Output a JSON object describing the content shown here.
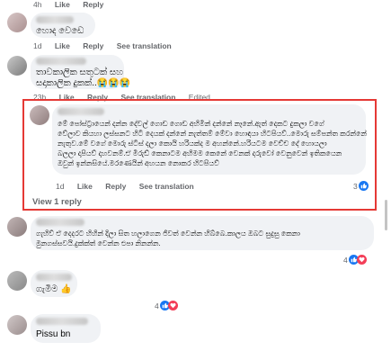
{
  "actions": {
    "like": "Like",
    "reply": "Reply",
    "see_translation": "See translation",
    "edited": "Edited",
    "view_replies": "View 1 reply"
  },
  "comments": [
    {
      "time": "4h",
      "text": ""
    },
    {
      "time": "1d",
      "text": "හොද වෙඩෙ"
    },
    {
      "time": "23h",
      "text_line1": "තාවකාලික සතුටක් සහ",
      "text_line2": "සදාකාලික දුකක්..😭😭😭"
    },
    {
      "time": "1d",
      "text_lines": [
        "මේ පෝස්ට්‍රායෙන් දන්න දේවල් ගොඩ ගොඩ අහිමින් දන්නේ නෑනේ.ඇත් දෙකට දුකලා වගේ",
        "වේලාව කියහා ලස්සනට හිටි දෙයක් දන්නේ නැත්තම් මේවා හොඳයා හිටපියව්..මොරු සම්පන්ත කරන්නේ",
        "නැතුව.මේ වගේ මොරු ස්ටිස් දලා කොයි හරියක්ද ම අහන්නේ.හරියටම වෙච්ච දේ හොයලා",
        "බලලා දාපියව් දාහවනම්.ඒ මිරුඩ් කෙනාටම අහිමම කෙනේ වෙනක් දරුවෝ වෙනුවෙන් ඉතිකයෙන",
        "ඔවුන් ඉන්නසියේ.මරණෙයින් අහයන නොකර හිටපියව්"
      ],
      "reaction_count": "3"
    },
    {
      "text": "ගැහිව් ඒ දෙදරට හිහින් දිලා සිත හලාගෙන ජිවත් වෙන්න හිබ්බෙ.කාලය ඔබට සුදුසු කෙනා",
      "text2": "මුනගස්සවයි.දුක්ක්ත් වෙන්න එපා නිනන්න.",
      "reaction_count": "4"
    },
    {
      "text": "ගැමිම 👍",
      "reaction_count": "4"
    },
    {
      "text": "Pissu bn"
    }
  ]
}
